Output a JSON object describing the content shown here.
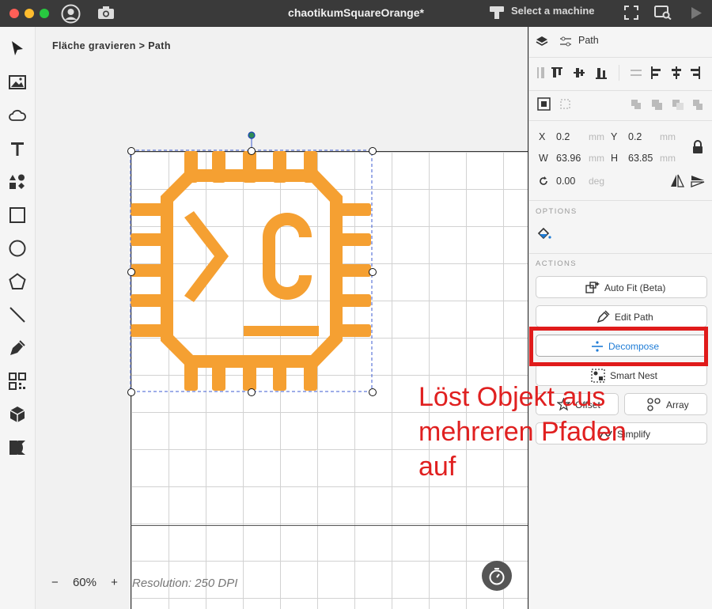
{
  "window": {
    "title": "chaotikumSquareOrange*",
    "machine_label": "Select a machine"
  },
  "canvas": {
    "breadcrumb": "Fläche gravieren > Path",
    "zoom_minus": "−",
    "zoom_level": "60%",
    "zoom_plus": "+",
    "resolution": "Resolution: 250 DPI",
    "art_color": "#f5a032"
  },
  "panel": {
    "tab_label": "Path",
    "x_label": "X",
    "x_value": "0.2",
    "x_unit": "mm",
    "y_label": "Y",
    "y_value": "0.2",
    "y_unit": "mm",
    "w_label": "W",
    "w_value": "63.96",
    "w_unit": "mm",
    "h_label": "H",
    "h_value": "63.85",
    "h_unit": "mm",
    "rot_value": "0.00",
    "rot_unit": "deg",
    "options_heading": "OPTIONS",
    "actions_heading": "ACTIONS",
    "actions": {
      "auto_fit": "Auto Fit (Beta)",
      "edit_path": "Edit Path",
      "decompose": "Decompose",
      "smart_nest": "Smart Nest",
      "offset": "Offset",
      "array": "Array",
      "simplify": "Simplify"
    }
  },
  "annotation": {
    "line1": "Löst Objekt aus",
    "line2": "mehreren Pfaden",
    "line3": "auf",
    "color": "#e02020"
  }
}
